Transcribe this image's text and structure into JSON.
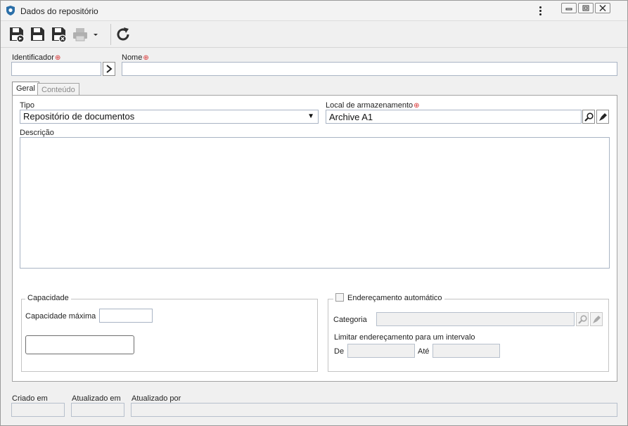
{
  "window": {
    "title": "Dados do repositório"
  },
  "toolbar": {
    "buttons": [
      "save-new",
      "save",
      "save-close",
      "print",
      "refresh"
    ]
  },
  "form": {
    "identificador_label": "Identificador",
    "identificador_value": "",
    "nome_label": "Nome",
    "nome_value": ""
  },
  "tabs": [
    {
      "label": "Geral",
      "active": true
    },
    {
      "label": "Conteúdo",
      "active": false
    }
  ],
  "geral": {
    "tipo_label": "Tipo",
    "tipo_value": "Repositório de documentos",
    "local_label": "Local de armazenamento",
    "local_value": "Archive A1",
    "descricao_label": "Descrição",
    "descricao_value": ""
  },
  "capacidade": {
    "legend": "Capacidade",
    "max_label": "Capacidade máxima",
    "max_value": ""
  },
  "enderecamento": {
    "legend": "Endereçamento automático",
    "checked": false,
    "categoria_label": "Categoria",
    "categoria_value": "",
    "limit_label": "Limitar endereçamento para um intervalo",
    "de_label": "De",
    "de_value": "",
    "ate_label": "Até",
    "ate_value": ""
  },
  "footer": {
    "criado_label": "Criado em",
    "atualizado_em_label": "Atualizado em",
    "atualizado_por_label": "Atualizado por"
  },
  "colors": {
    "required": "#d83030",
    "input_border": "#a9b4c4",
    "window_bg": "#f0f0f0"
  }
}
